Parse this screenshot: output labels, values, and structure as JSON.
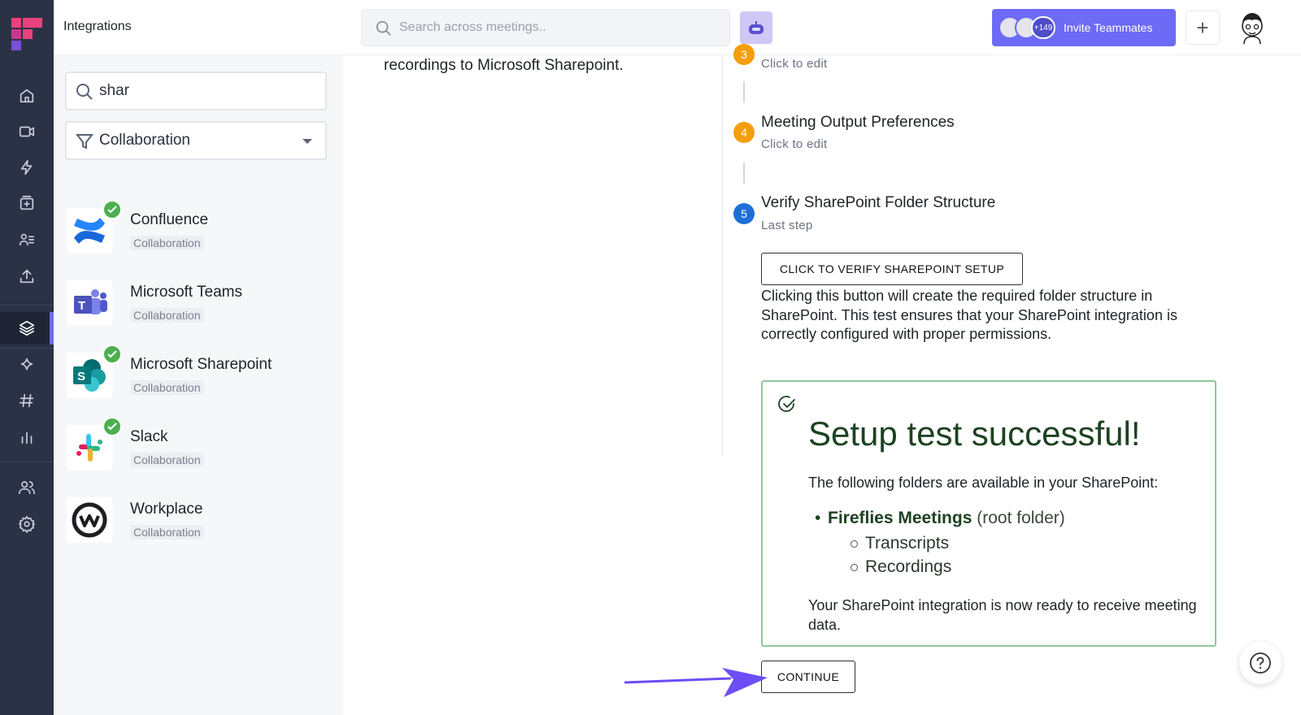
{
  "topbar": {
    "title": "Integrations",
    "search_placeholder": "Search across meetings..",
    "invite_count": "+149",
    "invite_label": "Invite Teammates"
  },
  "filters": {
    "search_value": "shar",
    "category": "Collaboration"
  },
  "integrations": [
    {
      "name": "Confluence",
      "category": "Collaboration",
      "connected": true
    },
    {
      "name": "Microsoft Teams",
      "category": "Collaboration",
      "connected": false
    },
    {
      "name": "Microsoft Sharepoint",
      "category": "Collaboration",
      "connected": true
    },
    {
      "name": "Slack",
      "category": "Collaboration",
      "connected": true
    },
    {
      "name": "Workplace",
      "category": "Collaboration",
      "connected": false
    }
  ],
  "middle": {
    "description_tail": "recordings to Microsoft Sharepoint."
  },
  "steps": [
    {
      "number": "3",
      "title": "",
      "subtitle": "Click to edit",
      "color": "#f59e0b"
    },
    {
      "number": "4",
      "title": "Meeting Output Preferences",
      "subtitle": "Click to edit",
      "color": "#f59e0b"
    },
    {
      "number": "5",
      "title": "Verify SharePoint Folder Structure",
      "subtitle": "Last step",
      "color": "#1d6fd8"
    }
  ],
  "verify": {
    "button_label": "CLICK TO VERIFY SHAREPOINT SETUP",
    "description": "Clicking this button will create the required folder structure in SharePoint. This test ensures that your SharePoint integration is correctly configured with proper permissions."
  },
  "success": {
    "title": "Setup test successful!",
    "intro": "The following folders are available in your SharePoint:",
    "root_folder": "Fireflies Meetings",
    "root_note": " (root folder)",
    "subfolders": [
      "Transcripts",
      "Recordings"
    ],
    "outro": "Your SharePoint integration is now ready to receive meeting data."
  },
  "continue_label": "CONTINUE",
  "colors": {
    "rail": "#2b3245",
    "accent": "#6d6af5",
    "success_border": "#8fc79a",
    "success_text": "#1d4221",
    "check_green": "#4caf50"
  }
}
